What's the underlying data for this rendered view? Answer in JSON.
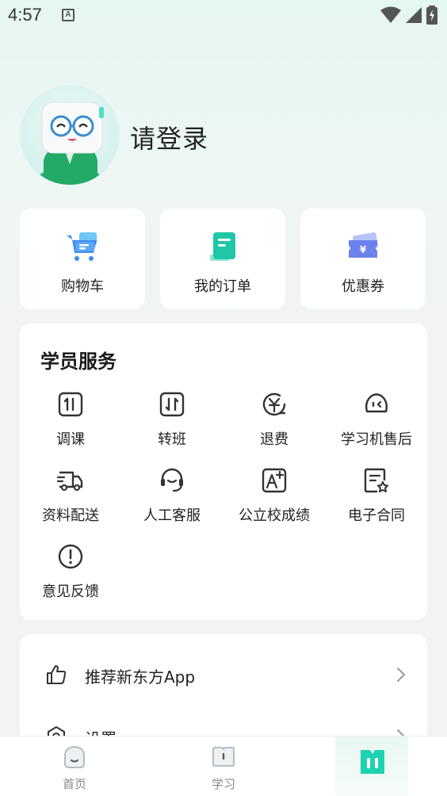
{
  "status_bar": {
    "time": "4:57",
    "notif_letter": "A"
  },
  "profile": {
    "login_text": "请登录"
  },
  "quick_actions": [
    {
      "label": "购物车",
      "icon": "shopping-cart-icon"
    },
    {
      "label": "我的订单",
      "icon": "order-icon"
    },
    {
      "label": "优惠券",
      "icon": "coupon-icon"
    }
  ],
  "services": {
    "title": "学员服务",
    "items": [
      {
        "label": "调课",
        "icon": "adjust-class-icon"
      },
      {
        "label": "转班",
        "icon": "transfer-class-icon"
      },
      {
        "label": "退费",
        "icon": "refund-icon"
      },
      {
        "label": "学习机售后",
        "icon": "device-aftersale-icon"
      },
      {
        "label": "资料配送",
        "icon": "delivery-truck-icon"
      },
      {
        "label": "人工客服",
        "icon": "headset-icon"
      },
      {
        "label": "公立校成绩",
        "icon": "grade-icon"
      },
      {
        "label": "电子合同",
        "icon": "contract-icon"
      },
      {
        "label": "意见反馈",
        "icon": "feedback-icon"
      }
    ]
  },
  "settings": {
    "items": [
      {
        "label": "推荐新东方App",
        "icon": "thumbs-up-icon"
      },
      {
        "label": "设置",
        "icon": "settings-icon"
      }
    ]
  },
  "bottom_nav": [
    {
      "label": "首页",
      "icon": "home-icon",
      "active": false
    },
    {
      "label": "学习",
      "icon": "study-icon",
      "active": false
    },
    {
      "label": "",
      "icon": "profile-tab-icon",
      "active": true
    }
  ],
  "colors": {
    "accent": "#1fc7a6",
    "blue": "#3d8bf2",
    "text": "#222222"
  }
}
